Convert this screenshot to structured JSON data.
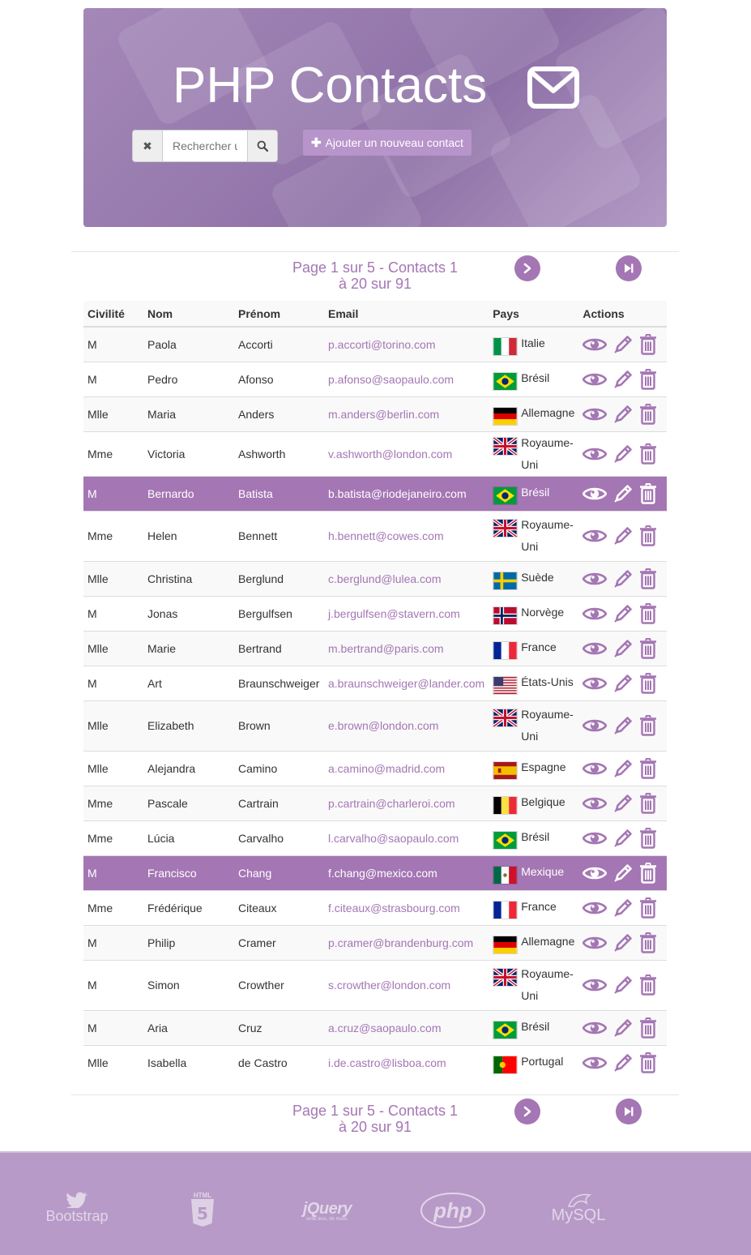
{
  "header": {
    "title": "PHP Contacts",
    "search_placeholder": "Rechercher u",
    "add_button_label": "Ajouter un nouveau contact"
  },
  "pagination": {
    "info_line1": "Page 1 sur 5 - Contacts 1",
    "info_line2": "à 20 sur 91"
  },
  "table": {
    "columns": [
      "Civilité",
      "Nom",
      "Prénom",
      "Email",
      "Pays",
      "Actions"
    ],
    "rows": [
      {
        "civilite": "M",
        "nom": "Paola",
        "prenom": "Accorti",
        "email": "p.accorti@torino.com",
        "pays": "Italie",
        "flag": "it"
      },
      {
        "civilite": "M",
        "nom": "Pedro",
        "prenom": "Afonso",
        "email": "p.afonso@saopaulo.com",
        "pays": "Brésil",
        "flag": "br"
      },
      {
        "civilite": "Mlle",
        "nom": "Maria",
        "prenom": "Anders",
        "email": "m.anders@berlin.com",
        "pays": "Allemagne",
        "flag": "de"
      },
      {
        "civilite": "Mme",
        "nom": "Victoria",
        "prenom": "Ashworth",
        "email": "v.ashworth@london.com",
        "pays": "Royaume-Uni",
        "flag": "gb"
      },
      {
        "civilite": "M",
        "nom": "Bernardo",
        "prenom": "Batista",
        "email": "b.batista@riodejaneiro.com",
        "pays": "Brésil",
        "flag": "br"
      },
      {
        "civilite": "Mme",
        "nom": "Helen",
        "prenom": "Bennett",
        "email": "h.bennett@cowes.com",
        "pays": "Royaume-Uni",
        "flag": "gb"
      },
      {
        "civilite": "Mlle",
        "nom": "Christina",
        "prenom": "Berglund",
        "email": "c.berglund@lulea.com",
        "pays": "Suède",
        "flag": "se"
      },
      {
        "civilite": "M",
        "nom": "Jonas",
        "prenom": "Bergulfsen",
        "email": "j.bergulfsen@stavern.com",
        "pays": "Norvège",
        "flag": "no"
      },
      {
        "civilite": "Mlle",
        "nom": "Marie",
        "prenom": "Bertrand",
        "email": "m.bertrand@paris.com",
        "pays": "France",
        "flag": "fr"
      },
      {
        "civilite": "M",
        "nom": "Art",
        "prenom": "Braunschweiger",
        "email": "a.braunschweiger@lander.com",
        "pays": "États-Unis",
        "flag": "us"
      },
      {
        "civilite": "Mlle",
        "nom": "Elizabeth",
        "prenom": "Brown",
        "email": "e.brown@london.com",
        "pays": "Royaume-Uni",
        "flag": "gb"
      },
      {
        "civilite": "Mlle",
        "nom": "Alejandra",
        "prenom": "Camino",
        "email": "a.camino@madrid.com",
        "pays": "Espagne",
        "flag": "es"
      },
      {
        "civilite": "Mme",
        "nom": "Pascale",
        "prenom": "Cartrain",
        "email": "p.cartrain@charleroi.com",
        "pays": "Belgique",
        "flag": "be"
      },
      {
        "civilite": "Mme",
        "nom": "Lúcia",
        "prenom": "Carvalho",
        "email": "l.carvalho@saopaulo.com",
        "pays": "Brésil",
        "flag": "br"
      },
      {
        "civilite": "M",
        "nom": "Francisco",
        "prenom": "Chang",
        "email": "f.chang@mexico.com",
        "pays": "Mexique",
        "flag": "mx"
      },
      {
        "civilite": "Mme",
        "nom": "Frédérique",
        "prenom": "Citeaux",
        "email": "f.citeaux@strasbourg.com",
        "pays": "France",
        "flag": "fr"
      },
      {
        "civilite": "M",
        "nom": "Philip",
        "prenom": "Cramer",
        "email": "p.cramer@brandenburg.com",
        "pays": "Allemagne",
        "flag": "de"
      },
      {
        "civilite": "M",
        "nom": "Simon",
        "prenom": "Crowther",
        "email": "s.crowther@london.com",
        "pays": "Royaume-Uni",
        "flag": "gb"
      },
      {
        "civilite": "M",
        "nom": "Aria",
        "prenom": "Cruz",
        "email": "a.cruz@saopaulo.com",
        "pays": "Brésil",
        "flag": "br"
      },
      {
        "civilite": "Mlle",
        "nom": "Isabella",
        "prenom": "de Castro",
        "email": "i.de.castro@lisboa.com",
        "pays": "Portugal",
        "flag": "pt"
      }
    ]
  },
  "footer": {
    "logos": [
      "Bootstrap",
      "HTML",
      "5",
      "jQuery",
      "write less, do more.",
      "php",
      "MySQL"
    ]
  },
  "colors": {
    "accent": "#a476b4",
    "header_bg": "#9679ad",
    "footer_bg": "#b79ac7"
  }
}
